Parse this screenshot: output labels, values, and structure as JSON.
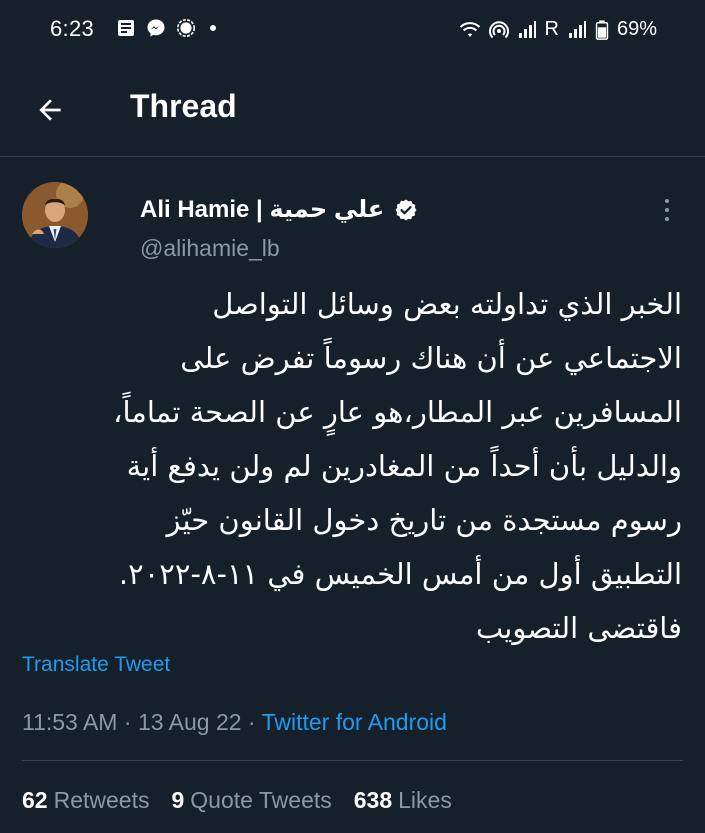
{
  "status_bar": {
    "time": "6:23",
    "battery": "69%",
    "carrier_indicator": "R"
  },
  "header": {
    "title": "Thread"
  },
  "tweet": {
    "author_name": "Ali Hamie | علي حمية",
    "author_handle": "@alihamie_lb",
    "text_lines": [
      "الخبر الذي تداولته بعض وسائل التواصل",
      "الاجتماعي عن أن هناك رسوماً تفرض على",
      "المسافرين عبر المطار،هو عارٍ عن الصحة تماماً،",
      "والدليل بأن أحداً من المغادرين لم ولن يدفع أية",
      "رسوم مستجدة من تاريخ دخول القانون حيّز",
      "التطبيق أول من أمس الخميس في ١١-٨-٢٠٢٢.",
      "فاقتضى التصويب"
    ],
    "translate_label": "Translate Tweet",
    "time": "11:53 AM",
    "date": "13 Aug 22",
    "separator": "·",
    "source": "Twitter for Android",
    "stats": {
      "retweets_count": "62",
      "retweets_label": "Retweets",
      "quotes_count": "9",
      "quotes_label": "Quote Tweets",
      "likes_count": "638",
      "likes_label": "Likes"
    }
  },
  "colors": {
    "background": "#15202b",
    "accent": "#1d9bf0",
    "secondary_text": "#8b98a5",
    "divider": "#38444d"
  }
}
